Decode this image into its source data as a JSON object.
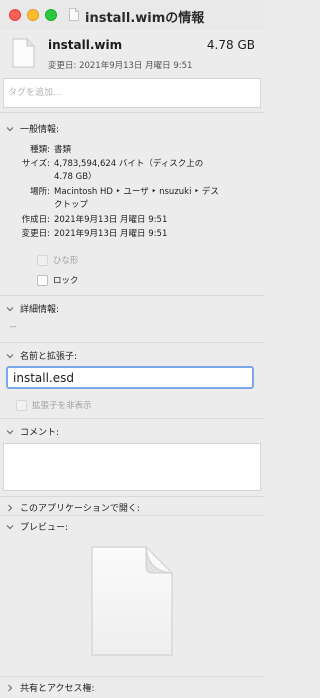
{
  "window": {
    "title": "install.wimの情報"
  },
  "header": {
    "file_name": "install.wim",
    "file_size": "4.78 GB",
    "modified": "変更日: 2021年9月13日 月曜日 9:51"
  },
  "tags": {
    "placeholder": "タグを追加..."
  },
  "general": {
    "title": "一般情報:",
    "rows": [
      {
        "label": "種類:",
        "value": "書類"
      },
      {
        "label": "サイズ:",
        "value_lines": [
          "4,783,594,624 バイト（ディスク上の",
          "4.78 GB）"
        ]
      },
      {
        "label": "場所:",
        "value_lines": [
          "Macintosh HD ‣ ユーザ ‣ nsuzuki ‣ デス",
          "クトップ"
        ]
      },
      {
        "label": "作成日:",
        "value": "2021年9月13日 月曜日 9:51"
      },
      {
        "label": "変更日:",
        "value": "2021年9月13日 月曜日 9:51"
      }
    ],
    "stationery_label": "ひな形",
    "locked_label": "ロック"
  },
  "more_info": {
    "title": "詳細情報:",
    "value": "--"
  },
  "name_ext": {
    "title": "名前と拡張子:",
    "value": "install.esd",
    "hide_ext_label": "拡張子を非表示"
  },
  "comments": {
    "title": "コメント:"
  },
  "open_with": {
    "title": "このアプリケーションで開く:"
  },
  "preview": {
    "title": "プレビュー:"
  },
  "sharing": {
    "title": "共有とアクセス権:"
  }
}
